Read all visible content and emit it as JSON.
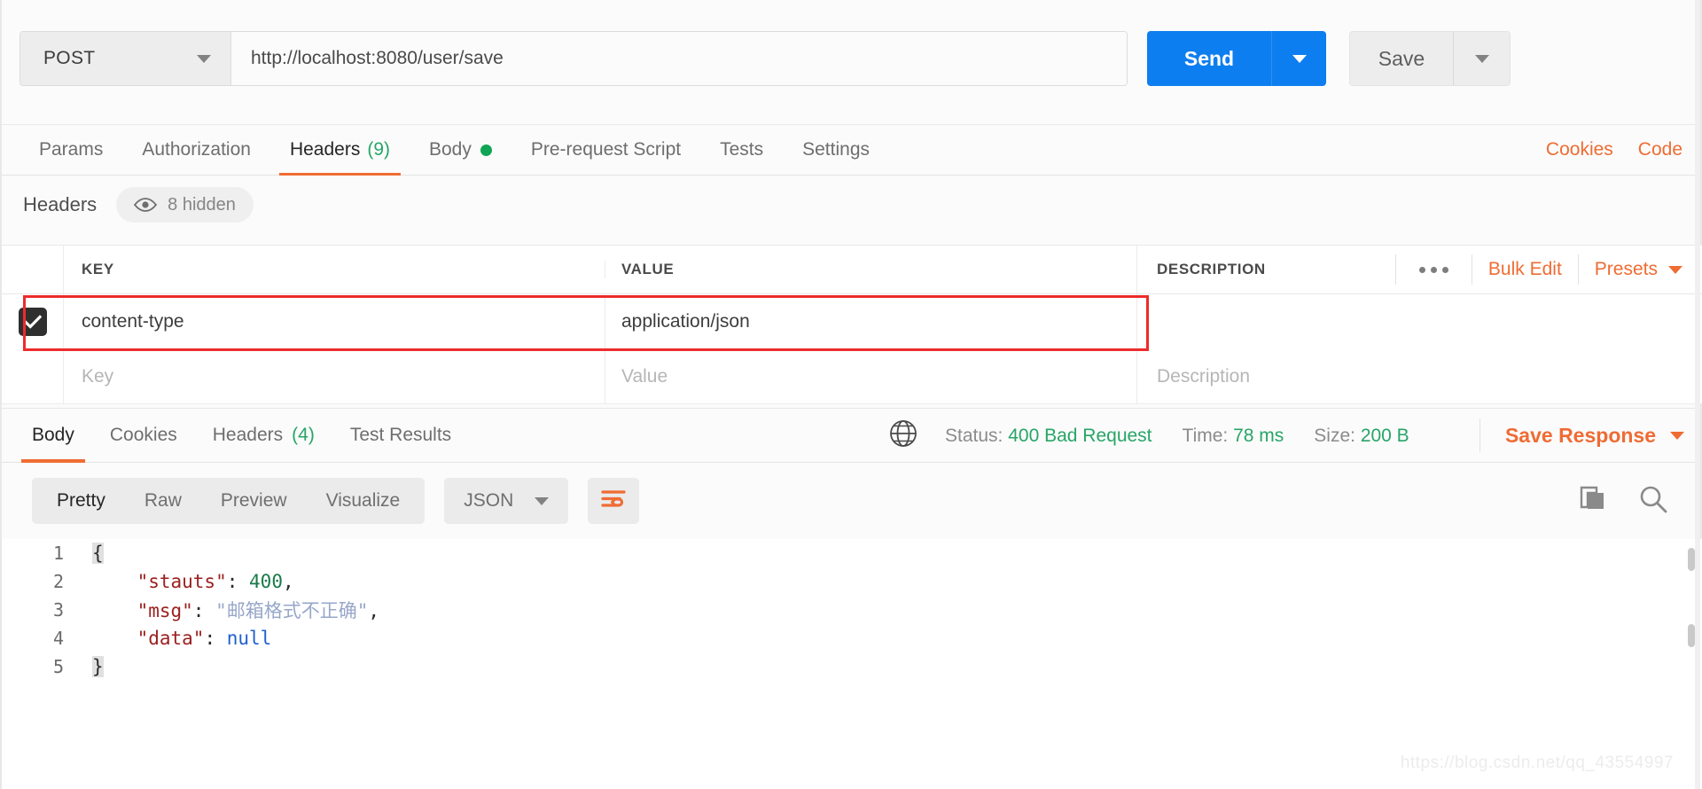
{
  "request": {
    "method": "POST",
    "method_icon": "chevron-down-icon",
    "url": "http://localhost:8080/user/save",
    "url_placeholder": "Enter request URL",
    "send_label": "Send",
    "save_label": "Save"
  },
  "request_tabs": {
    "items": [
      {
        "label": "Params",
        "count": "",
        "dot": false,
        "active": false
      },
      {
        "label": "Authorization",
        "count": "",
        "dot": false,
        "active": false
      },
      {
        "label": "Headers",
        "count": "(9)",
        "dot": false,
        "active": true
      },
      {
        "label": "Body",
        "count": "",
        "dot": true,
        "active": false
      },
      {
        "label": "Pre-request Script",
        "count": "",
        "dot": false,
        "active": false
      },
      {
        "label": "Tests",
        "count": "",
        "dot": false,
        "active": false
      },
      {
        "label": "Settings",
        "count": "",
        "dot": false,
        "active": false
      }
    ],
    "cookies_label": "Cookies",
    "code_label": "Code"
  },
  "headers_section": {
    "title": "Headers",
    "hidden_label": "8 hidden",
    "eye_icon": "eye-icon",
    "columns": [
      "KEY",
      "VALUE",
      "DESCRIPTION"
    ],
    "more_icon": "ellipsis-icon",
    "bulk_edit_label": "Bulk Edit",
    "presets_label": "Presets",
    "rows": [
      {
        "checked": true,
        "key": "content-type",
        "value": "application/json",
        "description": "",
        "highlighted": true
      }
    ],
    "placeholder_row": {
      "key": "Key",
      "value": "Value",
      "description": "Description"
    }
  },
  "response_tabs": {
    "items": [
      {
        "label": "Body",
        "count": "",
        "active": true
      },
      {
        "label": "Cookies",
        "count": "",
        "active": false
      },
      {
        "label": "Headers",
        "count": "(4)",
        "active": false
      },
      {
        "label": "Test Results",
        "count": "",
        "active": false
      }
    ],
    "globe_icon": "globe-icon",
    "status_label": "Status:",
    "status_value": "400 Bad Request",
    "time_label": "Time:",
    "time_value": "78 ms",
    "size_label": "Size:",
    "size_value": "200 B",
    "save_response_label": "Save Response"
  },
  "format_toolbar": {
    "views": [
      {
        "label": "Pretty",
        "active": true
      },
      {
        "label": "Raw",
        "active": false
      },
      {
        "label": "Preview",
        "active": false
      },
      {
        "label": "Visualize",
        "active": false
      }
    ],
    "language": "JSON",
    "wrap_icon": "word-wrap-icon",
    "copy_icon": "copy-icon",
    "search_icon": "search-icon"
  },
  "response_body": {
    "language": "json",
    "lines": [
      {
        "n": "1",
        "tokens": [
          {
            "t": "{",
            "c": "brace-hl k-punc"
          }
        ]
      },
      {
        "n": "2",
        "tokens": [
          {
            "t": "    ",
            "c": "k-punc"
          },
          {
            "t": "\"stauts\"",
            "c": "k-key"
          },
          {
            "t": ": ",
            "c": "k-punc"
          },
          {
            "t": "400",
            "c": "k-num"
          },
          {
            "t": ",",
            "c": "k-punc"
          }
        ]
      },
      {
        "n": "3",
        "tokens": [
          {
            "t": "    ",
            "c": "k-punc"
          },
          {
            "t": "\"msg\"",
            "c": "k-key"
          },
          {
            "t": ": ",
            "c": "k-punc"
          },
          {
            "t": "\"邮箱格式不正确\"",
            "c": "k-str"
          },
          {
            "t": ",",
            "c": "k-punc"
          }
        ]
      },
      {
        "n": "4",
        "tokens": [
          {
            "t": "    ",
            "c": "k-punc"
          },
          {
            "t": "\"data\"",
            "c": "k-key"
          },
          {
            "t": ": ",
            "c": "k-punc"
          },
          {
            "t": "null",
            "c": "k-null"
          }
        ]
      },
      {
        "n": "5",
        "tokens": [
          {
            "t": "}",
            "c": "brace-hl k-punc"
          }
        ]
      }
    ]
  },
  "watermark": {
    "text": "https://blog.csdn.net/qq_43554997"
  },
  "colors": {
    "accent_orange": "#ef6c33",
    "send_blue": "#0d7ef0",
    "status_green": "#27a567",
    "highlight_red": "#ee2b2b"
  }
}
